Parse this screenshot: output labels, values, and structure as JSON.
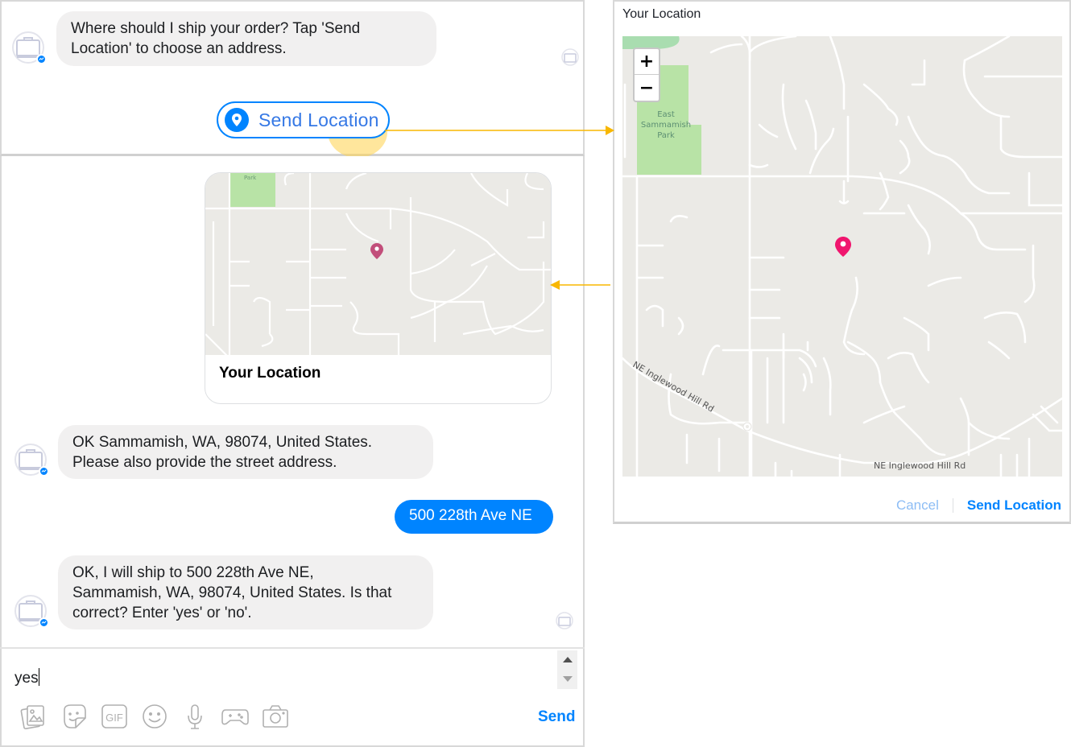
{
  "chat": {
    "messages": [
      {
        "from": "bot",
        "text_line1": "Where should I ship your order? Tap 'Send",
        "text_line2": "Location' to choose an address."
      },
      {
        "from": "user",
        "type": "location-card",
        "title": "Your Location"
      },
      {
        "from": "bot",
        "text_line1": "OK Sammamish, WA, 98074, United States.",
        "text_line2": "Please also provide the street address."
      },
      {
        "from": "user",
        "text": "500 228th Ave NE"
      },
      {
        "from": "bot",
        "text_line1": "OK, I will ship to 500 228th Ave NE,",
        "text_line2": "Sammamish, WA, 98074, United States. Is that",
        "text_line3": "correct? Enter 'yes' or 'no'."
      }
    ],
    "quick_reply": {
      "label": "Send Location",
      "icon": "location-pin-icon"
    },
    "composer": {
      "value": "yes",
      "send_label": "Send",
      "tools": [
        "photo-icon",
        "sticker-icon",
        "gif-icon",
        "emoji-icon",
        "microphone-icon",
        "game-controller-icon",
        "camera-icon"
      ],
      "gif_text": "GIF"
    }
  },
  "dialog": {
    "title": "Your Location",
    "map": {
      "park_label_line1": "East",
      "park_label_line2": "Sammamish",
      "park_label_line3": "Park",
      "road_label_1": "NE Inglewood Hill Rd",
      "road_label_2": "NE Inglewood Hill Rd",
      "zoom_in": "+",
      "zoom_out": "−"
    },
    "cancel_label": "Cancel",
    "send_label": "Send Location"
  },
  "card_map": {
    "park_label": "Park"
  },
  "colors": {
    "messenger_blue": "#0084ff",
    "bubble_gray": "#f1f0f0",
    "map_bg": "#ebeae6",
    "park_green": "#b7e3a4",
    "pin_pink": "#f0166e",
    "card_pin": "#c24e7a",
    "arrow_yellow": "#f8b700"
  }
}
